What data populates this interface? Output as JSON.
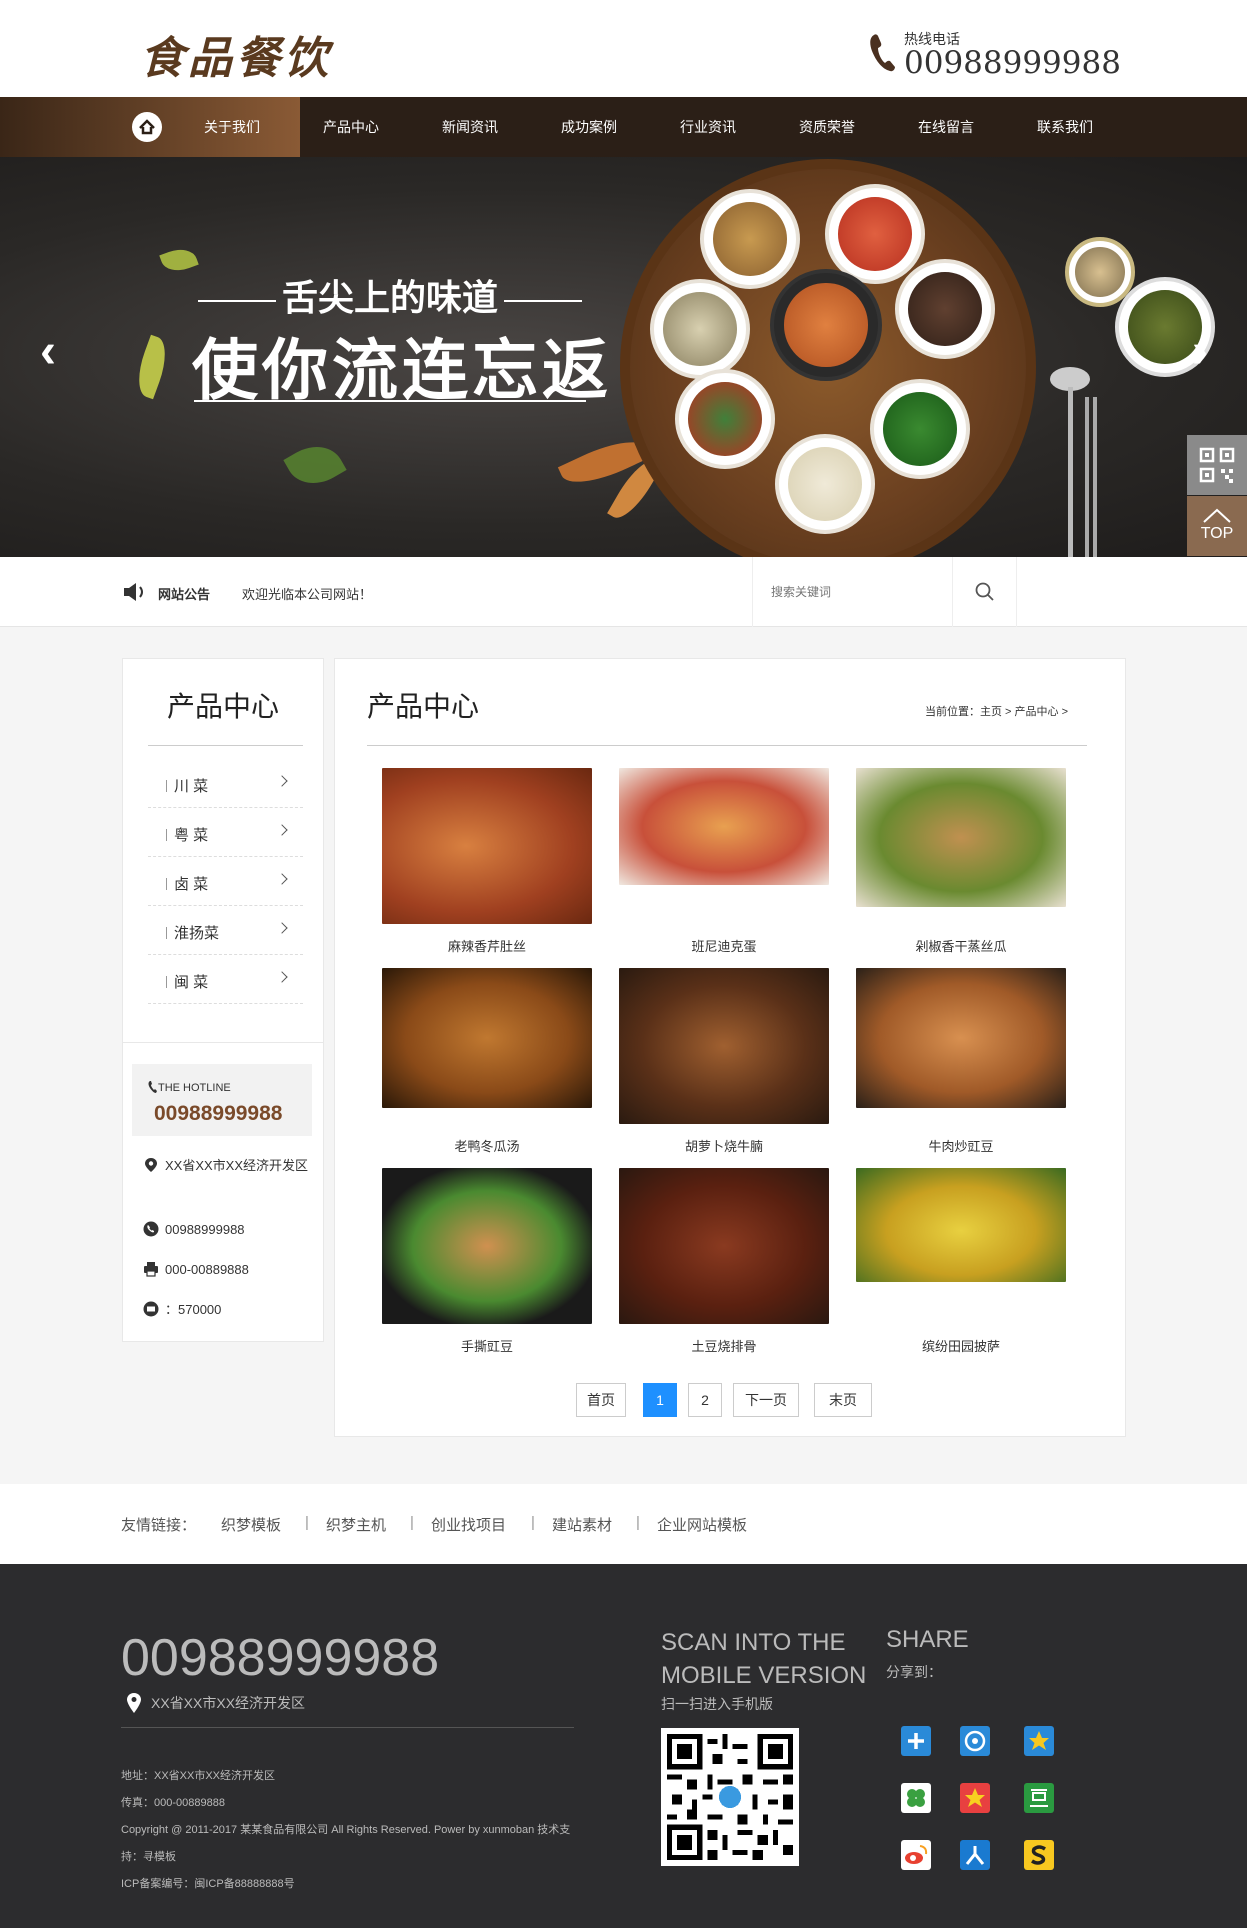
{
  "header": {
    "logo": "食品餐饮",
    "hotline_label": "热线电话",
    "hotline_number": "00988999988"
  },
  "nav": {
    "items": [
      "关于我们",
      "产品中心",
      "新闻资讯",
      "成功案例",
      "行业资讯",
      "资质荣誉",
      "在线留言",
      "联系我们"
    ]
  },
  "banner": {
    "line1": "舌尖上的味道",
    "line2": "使你流连忘返",
    "prev_arrow": "‹",
    "next_arrow": "›"
  },
  "side_buttons": {
    "top_label": "TOP"
  },
  "notice": {
    "title": "网站公告",
    "text": "欢迎光临本公司网站！",
    "search_placeholder": "搜索关键词"
  },
  "sidebar": {
    "title": "产品中心",
    "categories": [
      "川 菜",
      "粤 菜",
      "卤 菜",
      "淮扬菜",
      "闽 菜"
    ],
    "hotline_label": "THE HOTLINE",
    "hotline_number": "00988999988",
    "address": "XX省XX市XX经济开发区",
    "phone": "00988999988",
    "fax": "000-00889888",
    "postcode": "：570000"
  },
  "content": {
    "title": "产品中心",
    "breadcrumb": "当前位置：主页 > 产品中心 >",
    "products": [
      {
        "name": "麻辣香芹肚丝"
      },
      {
        "name": "班尼迪克蛋"
      },
      {
        "name": "剁椒香干蒸丝瓜"
      },
      {
        "name": "老鸭冬瓜汤"
      },
      {
        "name": "胡萝卜烧牛腩"
      },
      {
        "name": "牛肉炒豇豆"
      },
      {
        "name": "手撕豇豆"
      },
      {
        "name": "土豆烧排骨"
      },
      {
        "name": "缤纷田园披萨"
      }
    ],
    "pager": {
      "first": "首页",
      "page1": "1",
      "page2": "2",
      "next": "下一页",
      "last": "末页"
    }
  },
  "links": {
    "label": "友情链接：",
    "items": [
      "织梦模板",
      "织梦主机",
      "创业找项目",
      "建站素材",
      "企业网站模板"
    ],
    "separator": "|"
  },
  "footer": {
    "phone": "00988999988",
    "address": "XX省XX市XX经济开发区",
    "addr_line": "地址：XX省XX市XX经济开发区",
    "fax_line": "传真：000-00889888",
    "copyright1": "Copyright @ 2011-2017 某某食品有限公司 All Rights Reserved. Power by xunmoban 技术支",
    "copyright2": "持：寻模板",
    "icp": "ICP备案编号：闽ICP备88888888号",
    "scan_title1": "SCAN INTO THE",
    "scan_title2": "MOBILE VERSION",
    "scan_sub": "扫一扫进入手机版",
    "share_title": "SHARE",
    "share_sub": "分享到："
  },
  "colors": {
    "nav_bg": "#2b1f17",
    "accent_brown": "#7a4a2a",
    "pager_active": "#1e90ff",
    "footer_bg": "#2c2c2e"
  }
}
